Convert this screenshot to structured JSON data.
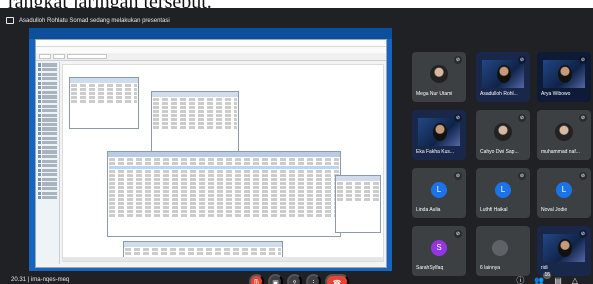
{
  "document": {
    "text": "rangkat jaringan tersebut."
  },
  "presentation": {
    "banner": "Asadulloh Rohlatu Somad sedang melakukan presentasi"
  },
  "participants": [
    {
      "name": "Mega Nur Utami",
      "type": "photo",
      "avatar_letter": "",
      "color": ""
    },
    {
      "name": "Asadulloh Rohl...",
      "type": "video",
      "avatar_letter": "",
      "color": ""
    },
    {
      "name": "Arya Wibowo",
      "type": "video",
      "avatar_letter": "",
      "color": ""
    },
    {
      "name": "Eka Fakha Kus...",
      "type": "video",
      "avatar_letter": "",
      "color": ""
    },
    {
      "name": "Cahyo Dwi Sap...",
      "type": "photo",
      "avatar_letter": "",
      "color": ""
    },
    {
      "name": "muhammad naf...",
      "type": "photo",
      "avatar_letter": "",
      "color": ""
    },
    {
      "name": "Linda Aulia",
      "type": "avatar",
      "avatar_letter": "L",
      "color": "#1a73e8"
    },
    {
      "name": "Luthfi Haikal",
      "type": "avatar",
      "avatar_letter": "L",
      "color": "#1a73e8"
    },
    {
      "name": "Noval Jodie",
      "type": "avatar",
      "avatar_letter": "L",
      "color": "#1a73e8"
    },
    {
      "name": "SarahSylfaq",
      "type": "avatar",
      "avatar_letter": "S",
      "color": "#9334e6"
    },
    {
      "name": "6 lainnya",
      "type": "group",
      "avatar_letter": "",
      "color": ""
    },
    {
      "name": "ridi",
      "type": "video",
      "avatar_letter": "",
      "color": ""
    }
  ],
  "meeting": {
    "time": "20.31",
    "code": "ima-nqes-meq",
    "separator": "|"
  },
  "controls": {
    "mic_icon": "mic-off-icon",
    "camera_icon": "camera-icon",
    "present_icon": "present-icon",
    "more_icon": "more-vert-icon",
    "end_icon": "call-end-icon"
  },
  "right_controls": {
    "info_icon": "info-icon",
    "people_count": "16",
    "chat_icon": "chat-icon",
    "activities_icon": "activities-icon"
  }
}
